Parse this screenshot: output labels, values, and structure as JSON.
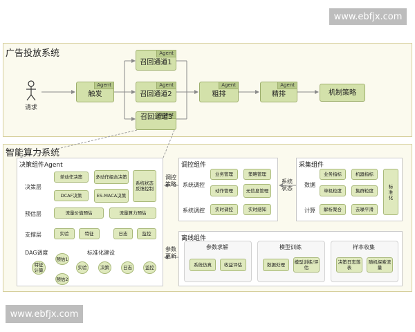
{
  "watermark_top": "www.ebfjx.com",
  "watermark_bottom": "www.ebfjx.com",
  "ad_system": {
    "title": "广告投放系统",
    "user_label": "请求",
    "agent_tag": "Agent",
    "trigger": "触发",
    "recall1": "召回通道1",
    "recall2": "召回通道2",
    "recall3": "召回通道3",
    "rough": "粗排",
    "fine": "精排",
    "mechanism": "机制策略"
  },
  "compute_system": {
    "title": "智能算力系统",
    "decision": {
      "title": "决策组件Agent",
      "layer_decision": "决策层",
      "layer_estimate": "预估层",
      "layer_support": "支撑层",
      "b_single": "单动作决策",
      "b_multi": "多动作组合决策",
      "b_dcaf": "DCAF决策",
      "b_esmaca": "ES-MACA决策",
      "b_state": "系统状态反馈控制",
      "b_traffic": "流量价值预估",
      "b_compute": "流量算力预估",
      "b_exp": "实验",
      "b_feature": "特征",
      "b_log": "日志",
      "b_monitor": "监控",
      "dag_title": "DAG调度",
      "std_title": "标准化建设",
      "c_feature_calc": "特征计算",
      "c_est1": "预估1",
      "c_est2": "预估2",
      "c_exp": "实验",
      "c_decision": "决策",
      "c_log": "日志",
      "c_monitor": "监控"
    },
    "control": {
      "title": "调控组件",
      "row1": "系统调控",
      "row2": "系统调控",
      "b_biz": "业务管理",
      "b_policy": "策略管理",
      "b_action": "动作管理",
      "b_meta": "元信息管理",
      "b_realtime_ctrl": "实时调控",
      "b_realtime_sense": "实时感知"
    },
    "collect": {
      "title": "采集组件",
      "row_data": "数据",
      "row_calc": "计算",
      "b_biz_metric": "业务指标",
      "b_machine_metric": "机器指标",
      "b_single_grain": "单机粒度",
      "b_cluster_grain": "集群粒度",
      "b_parse": "解析聚合",
      "b_denoise": "去噪平滑",
      "b_standard": "标准化"
    },
    "offline": {
      "title": "离线组件",
      "g_param": "参数求解",
      "g_model": "模型训练",
      "g_sample": "样本收集",
      "b_sim": "系统仿真",
      "b_revenue": "收益评估",
      "b_dataproc": "数据处理",
      "b_train_eval": "模型训练/评估",
      "b_decision_log": "决策日志落表",
      "b_random": "随机探索流量"
    },
    "arrows": {
      "control_policy": "调控策略",
      "system_state": "系统状态",
      "param_update": "参数更新"
    }
  }
}
